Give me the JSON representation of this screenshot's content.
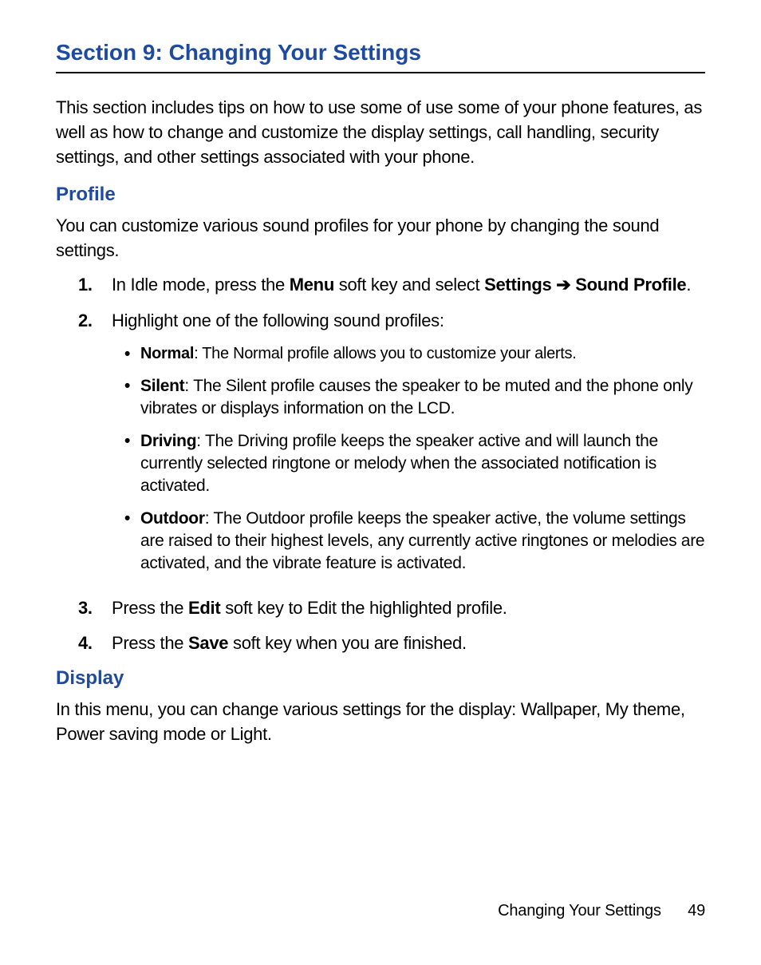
{
  "section_title": "Section 9: Changing Your Settings",
  "intro": "This section includes tips on how to use some of use some of your phone features, as well as how to change and customize the display settings, call handling, security settings, and other settings associated with your phone.",
  "profile": {
    "heading": "Profile",
    "intro": "You can customize various sound profiles for your phone by changing the sound settings.",
    "steps": {
      "s1": {
        "num": "1.",
        "pre": "In Idle mode, press the ",
        "k1": "Menu",
        "mid": " soft key and select ",
        "k2": "Settings",
        "arrow": " ➔ ",
        "k3": "Sound Profile",
        "post": "."
      },
      "s2": {
        "num": "2.",
        "text": "Highlight one of the following sound profiles:",
        "bullets": {
          "b1": {
            "label": "Normal",
            "desc": ": The Normal profile allows you to customize your alerts."
          },
          "b2": {
            "label": "Silent",
            "desc": ": The Silent profile causes the speaker to be muted and the phone only vibrates or displays information on the LCD."
          },
          "b3": {
            "label": "Driving",
            "desc": ": The Driving profile keeps the speaker active and will launch the currently selected ringtone or melody when the associated notification is activated."
          },
          "b4": {
            "label": "Outdoor",
            "desc": ": The Outdoor profile keeps the speaker active, the volume settings are raised to their highest levels, any currently active ringtones or melodies are activated, and the vibrate feature is activated."
          }
        }
      },
      "s3": {
        "num": "3.",
        "pre": "Press the ",
        "k1": "Edit",
        "post": " soft key to Edit the highlighted profile."
      },
      "s4": {
        "num": "4.",
        "pre": "Press the ",
        "k1": "Save",
        "post": " soft key when you are finished."
      }
    }
  },
  "display": {
    "heading": "Display",
    "intro": "In this menu, you can change various settings for the display: Wallpaper, My theme, Power saving mode or Light."
  },
  "footer": {
    "title": "Changing Your Settings",
    "page": "49"
  },
  "bullet_char": "•"
}
